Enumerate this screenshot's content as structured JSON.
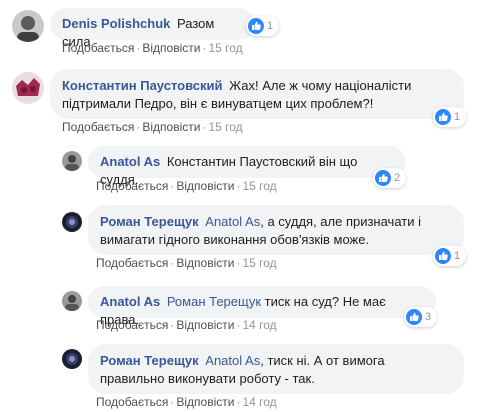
{
  "comments": [
    {
      "author": "Denis Polishchuk",
      "text": "Разом сила",
      "mention": "",
      "reactions": "1",
      "like": "Подобається",
      "reply": "Відповісти",
      "time": "15 год"
    },
    {
      "author": "Константин Паустовский",
      "text": "Жах! Але ж чому націоналісти підтримали Педро, він є винуватцем цих проблем?!",
      "mention": "",
      "reactions": "1",
      "like": "Подобається",
      "reply": "Відповісти",
      "time": "15 год"
    },
    {
      "author": "Anatol As",
      "text": "Константин Паустовский він що суддя.",
      "mention": "",
      "reactions": "2",
      "like": "Подобається",
      "reply": "Відповісти",
      "time": "15 год"
    },
    {
      "author": "Роман Терещук",
      "mention": "Anatol As",
      "text": ", а суддя, але призначати і вимагати гідного виконання обов'язків може.",
      "reactions": "1",
      "like": "Подобається",
      "reply": "Відповісти",
      "time": "15 год"
    },
    {
      "author": "Anatol As",
      "mention": "Роман Терещук",
      "text": " тиск на суд? Не має права.",
      "reactions": "3",
      "like": "Подобається",
      "reply": "Відповісти",
      "time": "14 год"
    },
    {
      "author": "Роман Терещук",
      "mention": "Anatol As",
      "text": ", тиск ні. А от вимога правильно виконувати роботу - так.",
      "reactions": "",
      "like": "Подобається",
      "reply": "Відповісти",
      "time": "14 год"
    }
  ],
  "colors": {
    "link": "#385898",
    "bubble": "#f2f3f5",
    "like": "#2d88ff"
  }
}
